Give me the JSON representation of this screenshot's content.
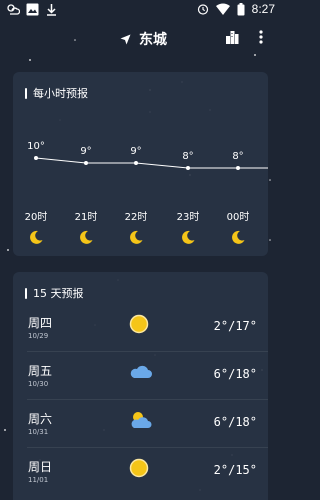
{
  "status_bar": {
    "time": "8:27",
    "left_icons": [
      "weather-icon",
      "image-icon",
      "download-icon"
    ],
    "right_icons": [
      "alarm-icon",
      "wifi-icon",
      "battery-icon"
    ]
  },
  "header": {
    "location_icon": "navigation-arrow-icon",
    "city": "东城",
    "right_icons": [
      "city-buildings-icon",
      "more-vert-icon"
    ]
  },
  "hourly": {
    "title": "每小时预报",
    "items": [
      {
        "temp": "10°",
        "temp_value": 10,
        "hour": "20时",
        "icon": "moon-icon"
      },
      {
        "temp": "9°",
        "temp_value": 9,
        "hour": "21时",
        "icon": "moon-icon"
      },
      {
        "temp": "9°",
        "temp_value": 9,
        "hour": "22时",
        "icon": "moon-icon"
      },
      {
        "temp": "8°",
        "temp_value": 8,
        "hour": "23时",
        "icon": "moon-icon"
      },
      {
        "temp": "8°",
        "temp_value": 8,
        "hour": "00时",
        "icon": "moon-icon"
      }
    ]
  },
  "daily": {
    "title": "15 天预报",
    "items": [
      {
        "day": "周四",
        "date": "10/29",
        "icon": "sun-icon",
        "temps": "2°/17°"
      },
      {
        "day": "周五",
        "date": "10/30",
        "icon": "cloud-icon",
        "temps": "6°/18°"
      },
      {
        "day": "周六",
        "date": "10/31",
        "icon": "partly-cloudy-icon",
        "temps": "6°/18°"
      },
      {
        "day": "周日",
        "date": "11/01",
        "icon": "sun-icon",
        "temps": "2°/15°"
      }
    ]
  },
  "colors": {
    "background": "#1d2533",
    "card": "#283344",
    "moon": "#f5c518",
    "sun": "#f5c518",
    "cloud": "#6aa8e8"
  }
}
